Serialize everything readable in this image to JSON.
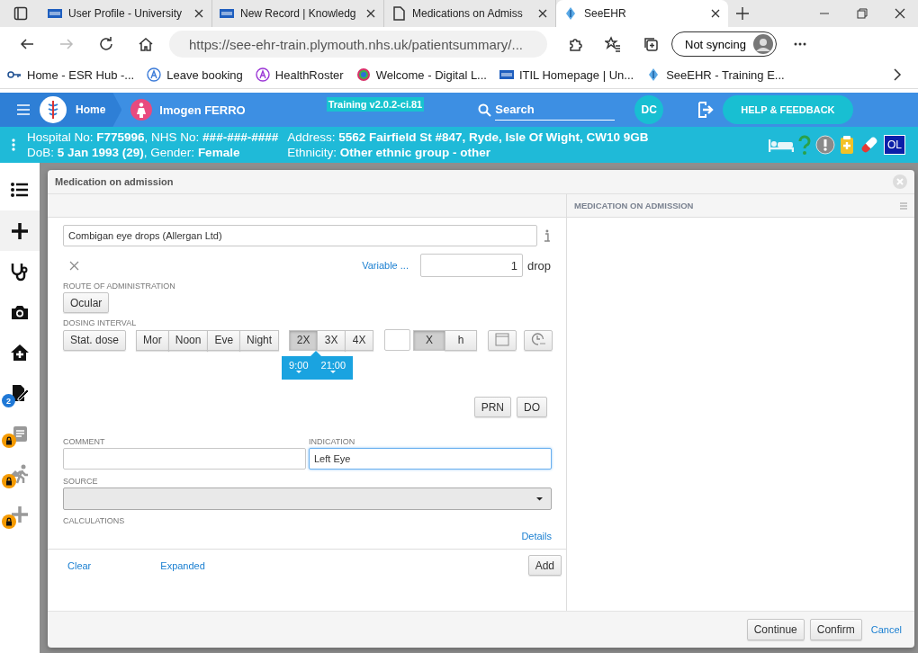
{
  "browser": {
    "tabs": [
      {
        "title": "User Profile - University",
        "kind": "nhs",
        "selected": false
      },
      {
        "title": "New Record | Knowledg",
        "kind": "nhs",
        "selected": false
      },
      {
        "title": "Medications on Admiss",
        "kind": "page",
        "selected": false
      },
      {
        "title": "SeeEHR",
        "kind": "app",
        "selected": true
      }
    ],
    "url": "https://see-ehr-train.plymouth.nhs.uk/patientsummary/...",
    "profile_button": "Not syncing",
    "bookmarks": [
      {
        "label": "Home - ESR Hub -...",
        "kind": "key"
      },
      {
        "label": "Leave booking",
        "kind": "a-blue"
      },
      {
        "label": "HealthRoster",
        "kind": "a-purple"
      },
      {
        "label": "Welcome - Digital L...",
        "kind": "ring"
      },
      {
        "label": "ITIL Homepage | Un...",
        "kind": "nhs"
      },
      {
        "label": "SeeEHR - Training E...",
        "kind": "app"
      }
    ]
  },
  "app_header": {
    "home": "Home",
    "patient": "Imogen FERRO",
    "version": "Training v2.0.2-ci.81",
    "search_placeholder": "Search",
    "user_initials": "DC",
    "help_button": "HELP & FEEDBACK"
  },
  "patient_banner": {
    "lines": [
      "Hospital No: **F775996**, NHS No: **###-###-####**",
      "DoB: **5 Jan 1993 (29)**, Gender: **Female**"
    ],
    "address_lines": [
      "Address: **5562 Fairfield St #847, Ryde, Isle Of Wight, CW10 9GB**",
      "Ethnicity: **Other ethnic group - other**"
    ],
    "badge": "OL"
  },
  "sidebar": {
    "items": [
      {
        "kind": "list",
        "selected": false,
        "locked": false
      },
      {
        "kind": "add",
        "selected": true,
        "locked": false
      },
      {
        "kind": "stethoscope",
        "selected": false,
        "locked": false
      },
      {
        "kind": "camera",
        "selected": false,
        "locked": false
      },
      {
        "kind": "house",
        "selected": false,
        "locked": false
      },
      {
        "kind": "note",
        "selected": false,
        "locked": false,
        "badge": "2"
      },
      {
        "kind": "clipboard",
        "selected": false,
        "locked": true
      },
      {
        "kind": "walker",
        "selected": false,
        "locked": true
      },
      {
        "kind": "add",
        "selected": false,
        "locked": true
      }
    ]
  },
  "modal": {
    "title": "Medication on admission",
    "drug_field": {
      "value": "Combigan eye drops (Allergan Ltd)"
    },
    "variable_link": "Variable ...",
    "dose": {
      "value": "1",
      "unit": "drop"
    },
    "route": {
      "label": "ROUTE OF ADMINISTRATION",
      "options": [
        {
          "label": "Ocular",
          "selected": false
        }
      ]
    },
    "dosing": {
      "label": "DOSING INTERVAL",
      "stat": {
        "label": "Stat. dose",
        "selected": false
      },
      "times": [
        {
          "label": "Mor",
          "selected": false
        },
        {
          "label": "Noon",
          "selected": false
        },
        {
          "label": "Eve",
          "selected": false
        },
        {
          "label": "Night",
          "selected": false
        }
      ],
      "frequency": [
        {
          "label": "2X",
          "selected": true
        },
        {
          "label": "3X",
          "selected": false
        },
        {
          "label": "4X",
          "selected": false
        }
      ],
      "units": [
        {
          "label": "X",
          "selected": true
        },
        {
          "label": "h",
          "selected": false
        }
      ],
      "time_chips": [
        "9:00",
        "21:00"
      ],
      "flags": [
        {
          "label": "PRN",
          "selected": false
        },
        {
          "label": "DO",
          "selected": false
        }
      ]
    },
    "comment": {
      "label": "COMMENT"
    },
    "indication": {
      "label": "INDICATION",
      "value": "Left Eye",
      "focused": true
    },
    "source": {
      "label": "SOURCE"
    },
    "calculations": {
      "label": "CALCULATIONS",
      "link": "Details"
    },
    "actions": {
      "clear": "Clear",
      "expanded": "Expanded",
      "add": "Add"
    },
    "list_panel": {
      "title": "MEDICATION ON ADMISSION"
    },
    "footer": {
      "continue": "Continue",
      "confirm": "Confirm",
      "cancel": "Cancel"
    }
  }
}
